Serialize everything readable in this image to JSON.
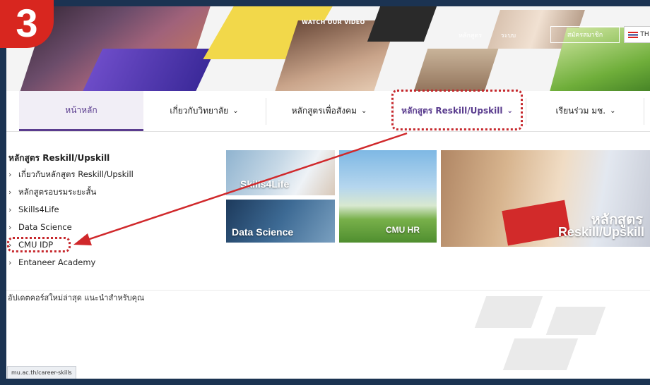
{
  "step_badge": "3",
  "hero": {
    "watch_video": "WATCH OUR VIDEO",
    "links": [
      "หลักสูตร",
      "ระบบ"
    ],
    "signup_button": "สมัครสมาชิก",
    "lang_label": "TH"
  },
  "nav": {
    "items": [
      {
        "label": "หน้าหลัก",
        "chevron": ""
      },
      {
        "label": "เกี่ยวกับวิทยาลัย",
        "chevron": "⌄"
      },
      {
        "label": "หลักสูตรเพื่อสังคม",
        "chevron": "⌄"
      },
      {
        "label": "หลักสูตร Reskill/Upskill",
        "chevron": "⌄"
      },
      {
        "label": "เรียนร่วม มช.",
        "chevron": "⌄"
      }
    ]
  },
  "menu": {
    "title": "หลักสูตร Reskill/Upskill",
    "items": [
      "เกี่ยวกับหลักสูตร Reskill/Upskill",
      "หลักสูตรอบรมระยะสั้น",
      "Skills4Life",
      "Data Science",
      "CMU IDP",
      "Entaneer Academy"
    ]
  },
  "tiles": {
    "skills": "Skills4Life",
    "data_science": "Data Science",
    "cmu_hr": "CMU HR",
    "reskill_line1": "หลักสูตร",
    "reskill_line2": "Reskill/Upskill"
  },
  "update_text": "อัปเดตคอร์สใหม่ล่าสุด แนะนำสำหรับคุณ",
  "status_url": "mu.ac.th/career-skills",
  "colors": {
    "accent": "#5a3c8e",
    "highlight": "#c6282d",
    "frame": "#1b3352"
  }
}
